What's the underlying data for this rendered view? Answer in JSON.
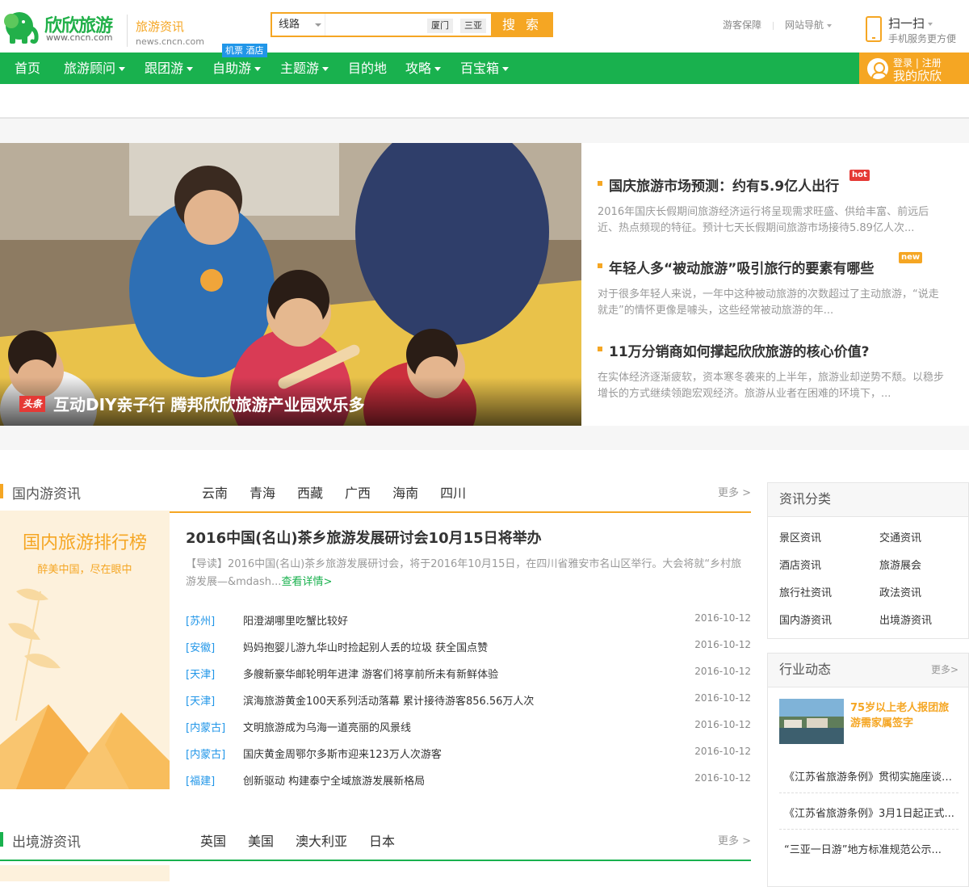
{
  "header": {
    "brand_name": "欣欣旅游",
    "brand_url": "www.cncn.com",
    "channel_name": "旅游资讯",
    "channel_url": "news.cncn.com",
    "search": {
      "category": "线路",
      "query": "",
      "hot_tags": [
        "厦门",
        "三亚"
      ],
      "button": "搜 索"
    },
    "top_links": [
      "游客保障",
      "网站导航"
    ],
    "scan_title": "扫一扫",
    "scan_subtitle": "手机服务更方便"
  },
  "nav": {
    "items": [
      "首页",
      "旅游顾问",
      "跟团游",
      "自助游",
      "主题游",
      "目的地",
      "攻略",
      "百宝箱"
    ],
    "flag": "机票 酒店",
    "login": "登录",
    "register": "注册",
    "my_account": "我的欣欣"
  },
  "hero": {
    "badge": "头条",
    "caption": "互动DIY亲子行 腾邦欣欣旅游产业园欢乐多"
  },
  "headlines": [
    {
      "title": "国庆旅游市场预测：约有5.9亿人出行",
      "mark": "hot",
      "summary": "2016年国庆长假期间旅游经济运行将呈现需求旺盛、供给丰富、前远后近、热点频现的特征。预计七天长假期间旅游市场接待5.89亿人次..."
    },
    {
      "title": "年轻人多“被动旅游”吸引旅行的要素有哪些",
      "mark": "new",
      "summary": "对于很多年轻人来说，一年中这种被动旅游的次数超过了主动旅游，“说走就走”的情怀更像是噱头，这些经常被动旅游的年..."
    },
    {
      "title": "11万分销商如何撑起欣欣旅游的核心价值?",
      "mark": "",
      "summary": "在实体经济逐渐疲软，资本寒冬袭来的上半年，旅游业却逆势不颓。以稳步增长的方式继续领跑宏观经济。旅游从业者在困难的环境下，..."
    }
  ],
  "domestic": {
    "name": "国内游资讯",
    "tabs": [
      "云南",
      "青海",
      "西藏",
      "广西",
      "海南",
      "四川"
    ],
    "more": "更多 >",
    "rank_title": "国内旅游排行榜",
    "rank_subtitle": "醉美中国，尽在眼中",
    "lead_title": "2016中国(名山)茶乡旅游发展研讨会10月15日将举办",
    "lead_summary": "【导读】2016中国(名山)茶乡旅游发展研讨会，将于2016年10月15日，在四川省雅安市名山区举行。大会将就“乡村旅游发展—&mdash...",
    "lead_link": "查看详情>",
    "rows": [
      {
        "region": "[苏州]",
        "title": "阳澄湖哪里吃蟹比较好",
        "date": "2016-10-12"
      },
      {
        "region": "[安徽]",
        "title": "妈妈抱婴儿游九华山时捡起别人丢的垃圾 获全国点赞",
        "date": "2016-10-12"
      },
      {
        "region": "[天津]",
        "title": "多艘新豪华邮轮明年进津 游客们将享前所未有新鲜体验",
        "date": "2016-10-12"
      },
      {
        "region": "[天津]",
        "title": "滨海旅游黄金100天系列活动落幕 累计接待游客856.56万人次",
        "date": "2016-10-12"
      },
      {
        "region": "[内蒙古]",
        "title": "文明旅游成为乌海一道亮丽的风景线",
        "date": "2016-10-12"
      },
      {
        "region": "[内蒙古]",
        "title": "国庆黄金周鄂尔多斯市迎来123万人次游客",
        "date": "2016-10-12"
      },
      {
        "region": "[福建]",
        "title": "创新驱动 构建泰宁全域旅游发展新格局",
        "date": "2016-10-12"
      }
    ]
  },
  "outbound": {
    "name": "出境游资讯",
    "tabs": [
      "英国",
      "美国",
      "澳大利亚",
      "日本"
    ],
    "more": "更多 >"
  },
  "sidebar": {
    "categories_title": "资讯分类",
    "categories": [
      "景区资讯",
      "交通资讯",
      "酒店资讯",
      "旅游展会",
      "旅行社资讯",
      "政法资讯",
      "国内游资讯",
      "出境游资讯"
    ],
    "industry_title": "行业动态",
    "industry_more": "更多>",
    "industry_featured": "75岁以上老人报团旅游需家属签字",
    "industry_list": [
      "《江苏省旅游条例》贯彻实施座谈会...",
      "《江苏省旅游条例》3月1日起正式...",
      "“三亚一日游”地方标准规范公示..."
    ]
  },
  "colors": {
    "green": "#19b14e",
    "orange": "#f5a623",
    "blue": "#2196e8",
    "red": "#e53935"
  }
}
